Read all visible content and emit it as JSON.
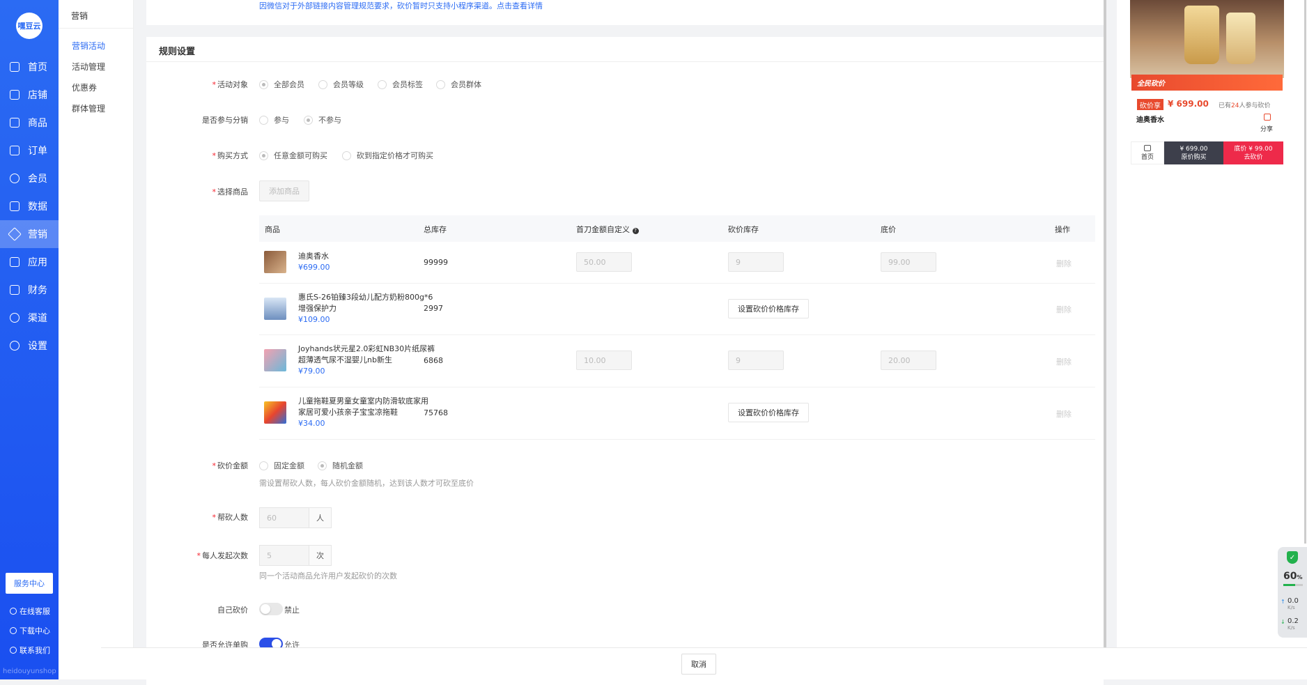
{
  "brand": {
    "logo": "嘿豆云",
    "watermark": "heidouyunshop"
  },
  "nav": [
    {
      "label": "首页"
    },
    {
      "label": "店铺"
    },
    {
      "label": "商品"
    },
    {
      "label": "订单"
    },
    {
      "label": "会员"
    },
    {
      "label": "数据"
    },
    {
      "label": "营销"
    },
    {
      "label": "应用"
    },
    {
      "label": "财务"
    },
    {
      "label": "渠道"
    },
    {
      "label": "设置"
    }
  ],
  "sidebar_footer": {
    "service_center": "服务中心",
    "online_service": "在线客服",
    "download_center": "下载中心",
    "contact_us": "联系我们"
  },
  "submenu": {
    "title": "营销",
    "items": [
      {
        "label": "营销活动"
      },
      {
        "label": "活动管理"
      },
      {
        "label": "优惠券"
      },
      {
        "label": "群体管理"
      }
    ]
  },
  "notice": "因微信对于外部链接内容管理规范要求，砍价暂时只支持小程序渠道。点击查看详情",
  "rules": {
    "title": "规则设置",
    "target": {
      "label": "活动对象",
      "options": [
        "全部会员",
        "会员等级",
        "会员标签",
        "会员群体"
      ],
      "selected": 0
    },
    "distribution": {
      "label": "是否参与分销",
      "options": [
        "参与",
        "不参与"
      ],
      "selected": 1
    },
    "buy_method": {
      "label": "购买方式",
      "options": [
        "任意金额可购买",
        "砍到指定价格才可购买"
      ],
      "selected": 0
    },
    "select_goods": {
      "label": "选择商品",
      "add_button": "添加商品"
    },
    "table": {
      "headers": [
        "商品",
        "总库存",
        "首刀金额自定义",
        "砍价库存",
        "底价",
        "操作"
      ],
      "rows": [
        {
          "name": "迪奥香水",
          "price": "¥699.00",
          "stock": "99999",
          "first_cut": "50.00",
          "bargain_stock": "9",
          "floor_price": "99.00",
          "action": "删除",
          "mode": "input"
        },
        {
          "name": "惠氏S-26铂臻3段幼儿配方奶粉800g*6 增强保护力",
          "price": "¥109.00",
          "stock": "2997",
          "set_label": "设置砍价价格库存",
          "action": "删除",
          "mode": "button"
        },
        {
          "name": "Joyhands状元星2.0彩虹NB30片纸尿裤 超薄透气尿不湿婴儿nb新生",
          "price": "¥79.00",
          "stock": "6868",
          "first_cut": "10.00",
          "bargain_stock": "9",
          "floor_price": "20.00",
          "action": "删除",
          "mode": "input"
        },
        {
          "name": "儿童拖鞋夏男童女童室内防滑软底家用 家居可爱小孩亲子宝宝凉拖鞋",
          "price": "¥34.00",
          "stock": "75768",
          "set_label": "设置砍价价格库存",
          "action": "删除",
          "mode": "button"
        }
      ]
    },
    "bargain_amount": {
      "label": "砍价金额",
      "options": [
        "固定金额",
        "随机金额"
      ],
      "selected": 1,
      "hint": "需设置帮砍人数，每人砍价金额随机，达到该人数才可砍至底价"
    },
    "helpers": {
      "label": "帮砍人数",
      "value": "60",
      "unit": "人"
    },
    "launch_times": {
      "label": "每人发起次数",
      "value": "5",
      "unit": "次",
      "hint": "同一个活动商品允许用户发起砍价的次数"
    },
    "self_bargain": {
      "label": "自己砍价",
      "state": "禁止",
      "on": false
    },
    "allow_single": {
      "label": "是否允许单购",
      "state": "允许",
      "on": true
    }
  },
  "footer": {
    "cancel": "取消"
  },
  "preview": {
    "banner": "全民砍价",
    "tag": "砍价享",
    "price": "¥ 699.00",
    "joined_prefix": "已有",
    "joined_count": "24",
    "joined_suffix": "人参与砍价",
    "name": "迪奥香水",
    "share": "分享",
    "home": "首页",
    "orig_price": "¥ 699.00",
    "orig_label": "原价购买",
    "floor_price": "底价 ¥ 99.00",
    "go_label": "去砍价"
  },
  "monitor": {
    "percent": "60",
    "pct_sign": "%",
    "up": "0.0",
    "down": "0.2",
    "unit": "K/s"
  }
}
